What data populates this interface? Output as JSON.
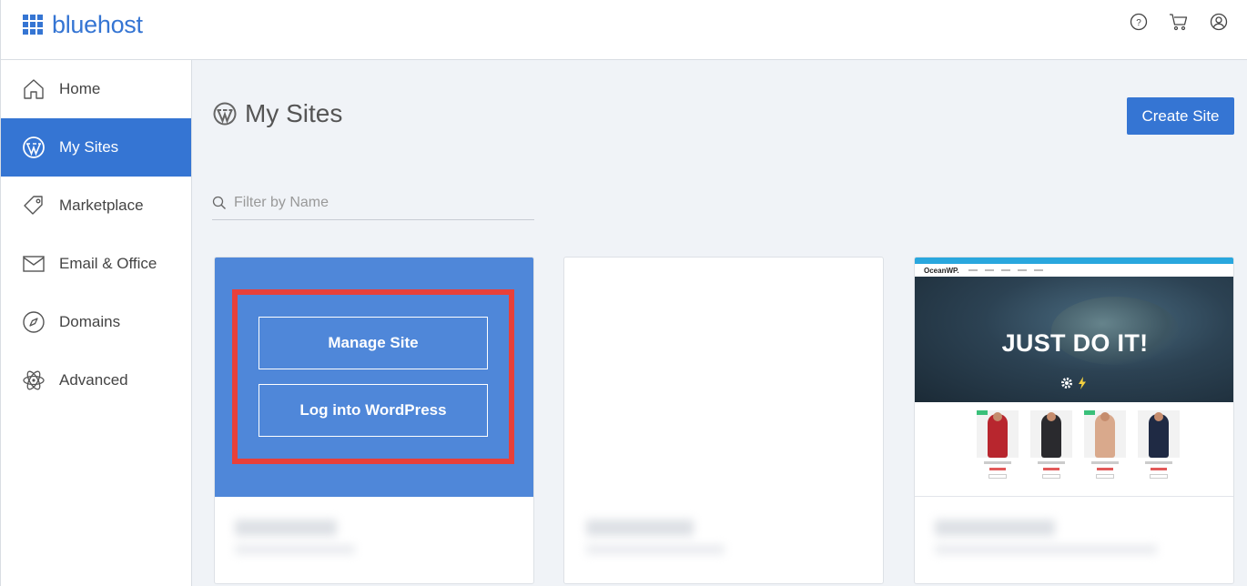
{
  "brand": {
    "name": "bluehost"
  },
  "header": {
    "icons": [
      "help-icon",
      "cart-icon",
      "user-icon"
    ]
  },
  "sidebar": {
    "items": [
      {
        "label": "Home",
        "icon": "home-icon",
        "active": false
      },
      {
        "label": "My Sites",
        "icon": "wordpress-icon",
        "active": true
      },
      {
        "label": "Marketplace",
        "icon": "tag-icon",
        "active": false
      },
      {
        "label": "Email & Office",
        "icon": "mail-icon",
        "active": false
      },
      {
        "label": "Domains",
        "icon": "compass-icon",
        "active": false
      },
      {
        "label": "Advanced",
        "icon": "atom-icon",
        "active": false
      }
    ]
  },
  "main": {
    "title": "My Sites",
    "create_button": "Create Site",
    "filter_placeholder": "Filter by Name",
    "cards": [
      {
        "manage_label": "Manage Site",
        "login_label": "Log into WordPress"
      },
      {},
      {
        "thumb": {
          "brand": "OceanWP.",
          "hero_text": "JUST DO IT!"
        }
      }
    ]
  },
  "colors": {
    "accent": "#3575d3",
    "card_overlay": "#4f87d9",
    "highlight": "#e8403a"
  }
}
